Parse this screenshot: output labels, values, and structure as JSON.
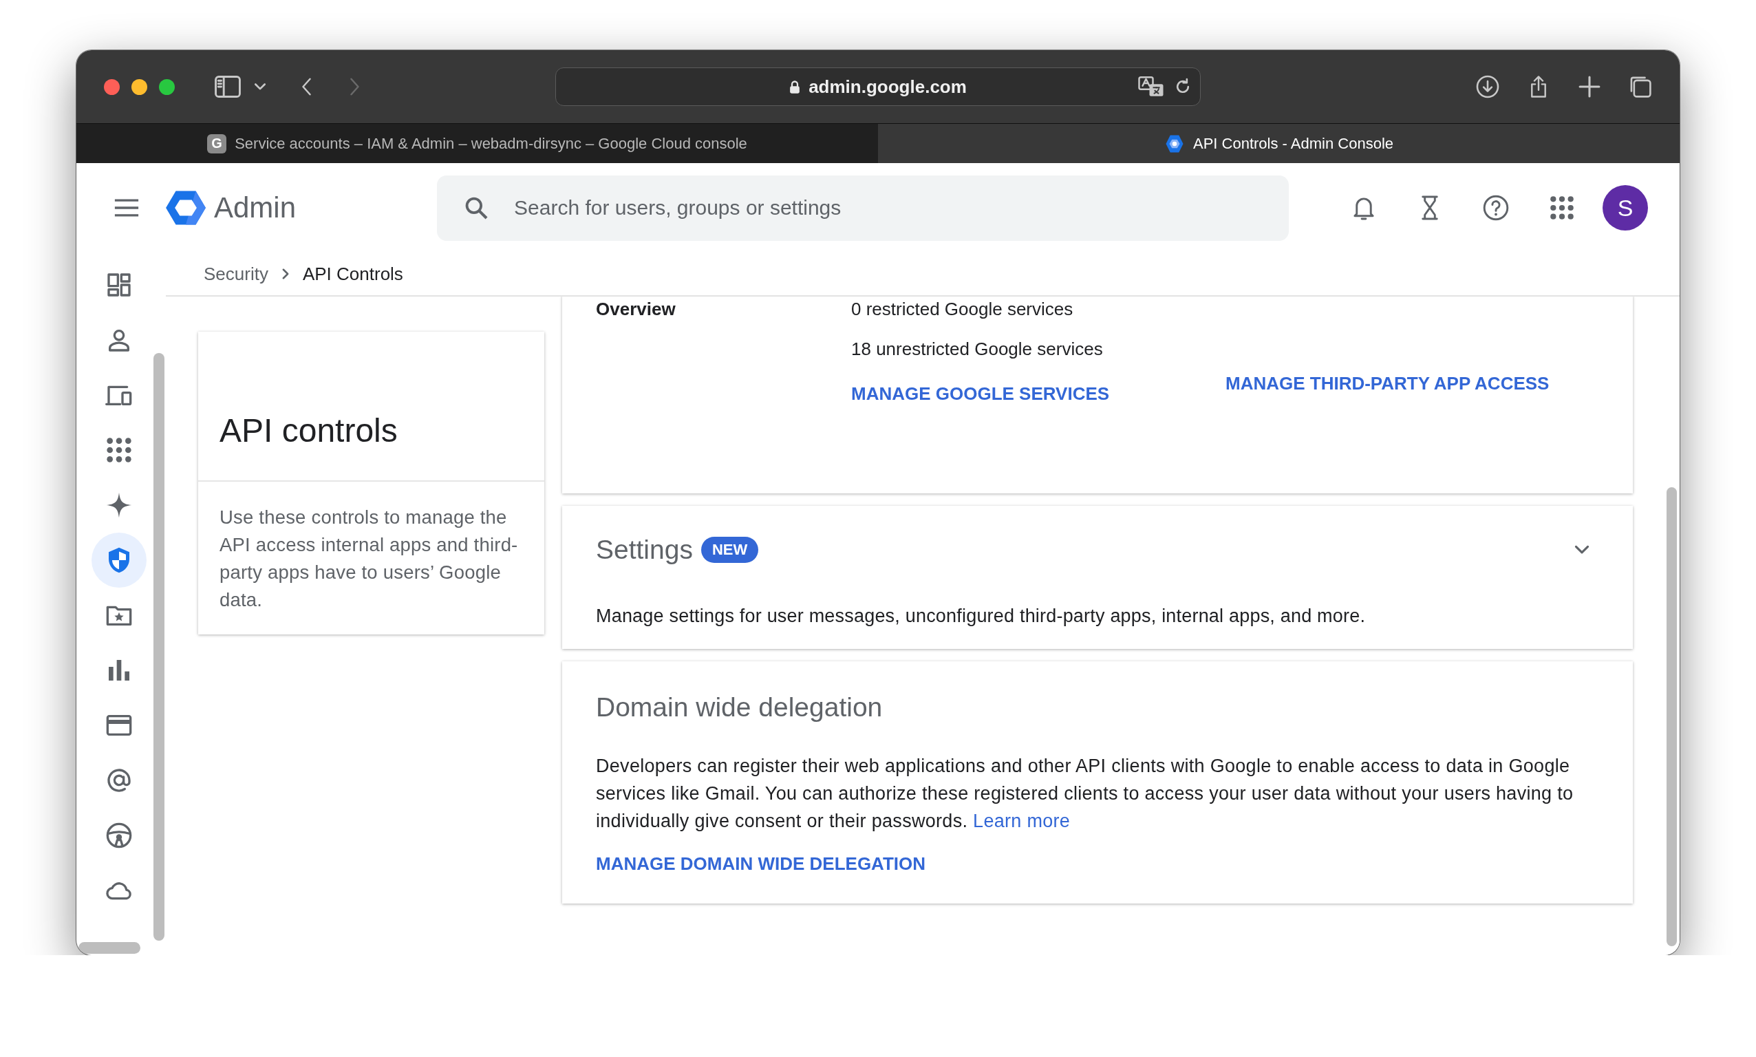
{
  "browser": {
    "url": "admin.google.com",
    "tabs": [
      {
        "title": "Service accounts – IAM & Admin – webadm-dirsync – Google Cloud console",
        "favicon": "G",
        "selected": false
      },
      {
        "title": "API Controls - Admin Console",
        "selected": true
      }
    ]
  },
  "header": {
    "product": "Admin",
    "search": {
      "placeholder": "Search for users, groups or settings"
    },
    "avatar": "S"
  },
  "sidebar": {
    "items": [
      {
        "kind": "dashboard",
        "selected": false
      },
      {
        "kind": "users",
        "selected": false
      },
      {
        "kind": "devices",
        "selected": false
      },
      {
        "kind": "apps",
        "selected": false
      },
      {
        "kind": "ai",
        "selected": false
      },
      {
        "kind": "security",
        "selected": true
      },
      {
        "kind": "rules",
        "selected": false
      },
      {
        "kind": "reporting",
        "selected": false
      },
      {
        "kind": "billing",
        "selected": false
      },
      {
        "kind": "account",
        "selected": false
      },
      {
        "kind": "migration",
        "selected": false
      },
      {
        "kind": "storage",
        "selected": false
      }
    ]
  },
  "breadcrumb": [
    "Security",
    "API Controls"
  ],
  "intro_card": {
    "title": "API controls",
    "description": "Use these controls to manage the API access internal apps and third-party apps have to users’ Google data."
  },
  "overview_card": {
    "label": "Overview",
    "lines": [
      "0 restricted Google services",
      "18 unrestricted Google services"
    ],
    "links": [
      "MANAGE GOOGLE SERVICES",
      "MANAGE THIRD-PARTY APP ACCESS"
    ]
  },
  "settings_card": {
    "title": "Settings",
    "badge": "NEW",
    "expanded": false,
    "description": "Manage settings for user messages, unconfigured third-party apps, internal apps, and more."
  },
  "delegation_card": {
    "title": "Domain wide delegation",
    "description": "Developers can register their web applications and other API clients with Google to enable access to data in Google services like Gmail. You can authorize these registered clients to access your user data without your users having to individually give consent or their passwords.",
    "link": "Learn more",
    "action": "MANAGE DOMAIN WIDE DELEGATION"
  }
}
